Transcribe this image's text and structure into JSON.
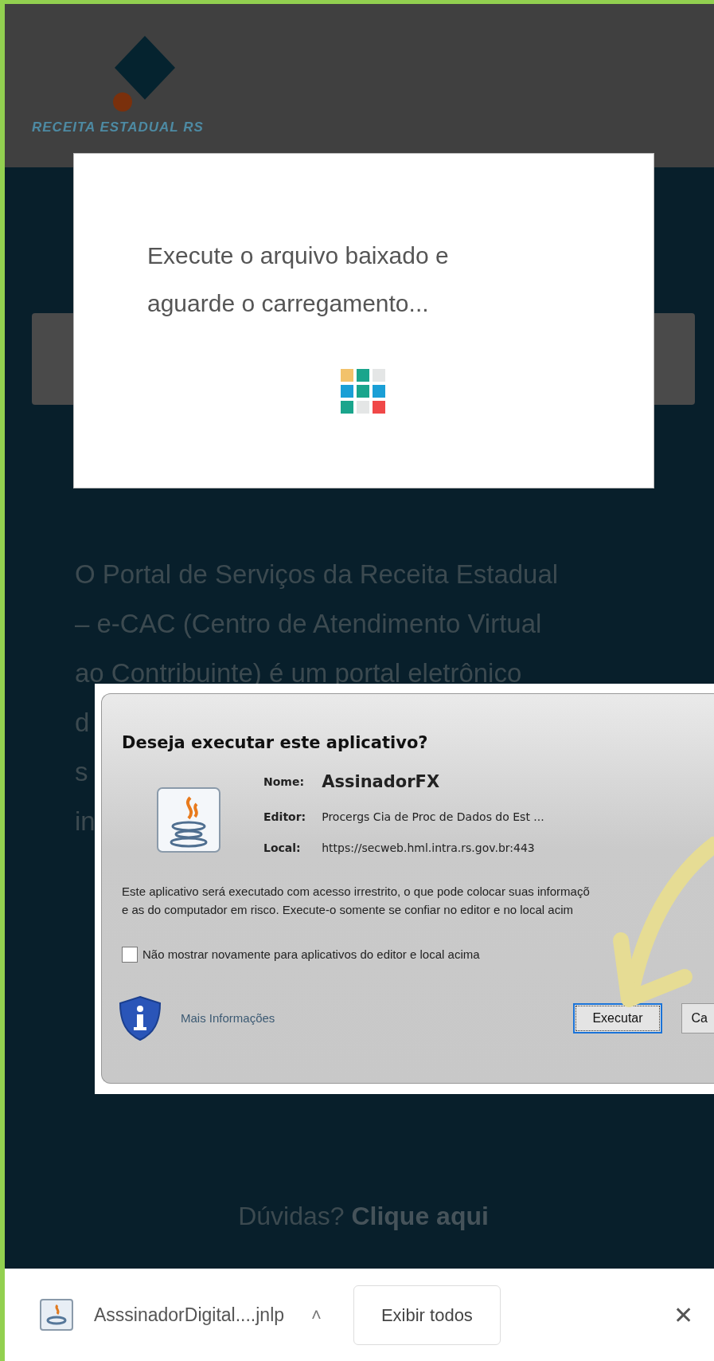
{
  "header": {
    "logo_text": "RECEITA ESTADUAL RS"
  },
  "intro_lines": [
    "O Portal de Serviços da Receita Estadual",
    "– e-CAC (Centro de Atendimento Virtual",
    "ao Contribuinte) é um portal eletrônico",
    "d",
    "s",
    "in"
  ],
  "help": {
    "text": "Dúvidas?",
    "link": "Clique aqui"
  },
  "loading_modal": {
    "message": "Execute o arquivo baixado e aguarde o carregamento..."
  },
  "security_dialog": {
    "title": "Deseja executar este aplicativo?",
    "fields": [
      {
        "label": "Nome:",
        "value": "AssinadorFX",
        "kind": "name"
      },
      {
        "label": "Editor:",
        "value": "Procergs Cia de Proc de Dados do Est ...",
        "kind": "plain"
      },
      {
        "label": "Local:",
        "value": "https://secweb.hml.intra.rs.gov.br:443",
        "kind": "plain"
      }
    ],
    "warning_lines": [
      "Este aplicativo será executado com acesso irrestrito, o que pode colocar suas informaçõ",
      "e as do computador em risco. Execute-o somente se confiar no editor e no local acim"
    ],
    "checkbox": {
      "label": "Não mostrar novamente para aplicativos do editor e local acima",
      "checked": false
    },
    "more_info": "Mais Informações",
    "buttons": [
      {
        "label": "Executar",
        "default": true
      },
      {
        "label": "Ca",
        "default": false
      }
    ]
  },
  "download_bar": {
    "file": "AsssinadorDigital....jnlp",
    "caret": "˄",
    "show_all": "Exibir todos",
    "close": "✕"
  }
}
